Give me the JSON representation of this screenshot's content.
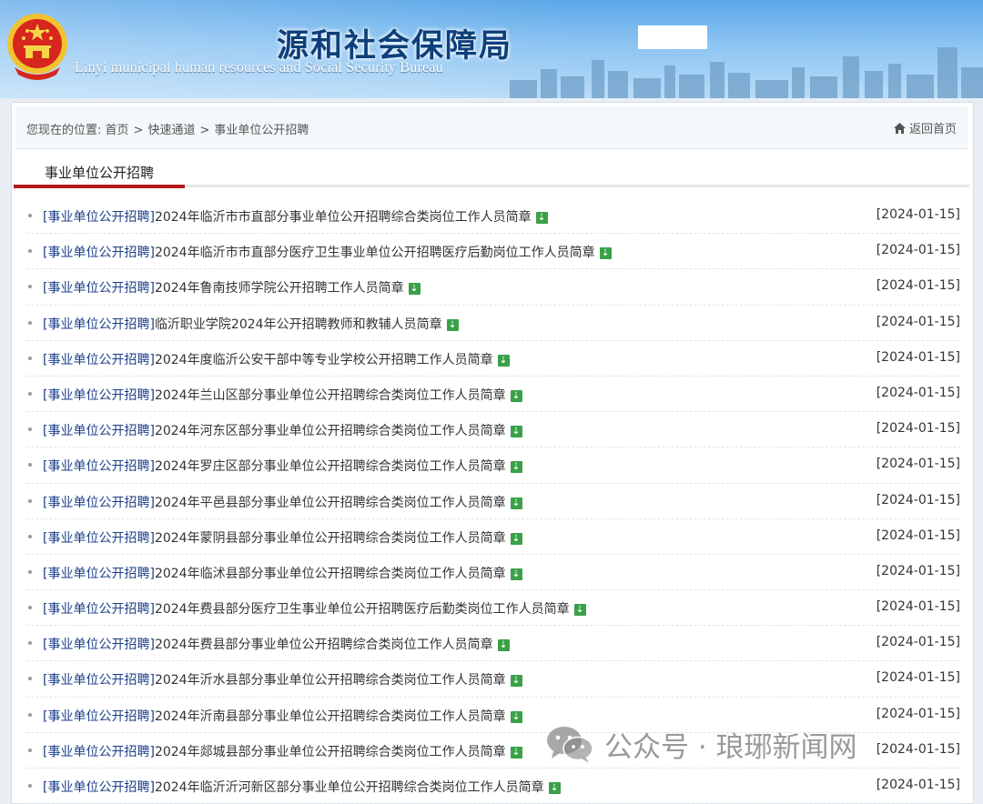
{
  "header": {
    "title": "源和社会保障局",
    "subtitle": "Linyi municipal human resources and Social Security Bureau"
  },
  "breadcrumb": {
    "prefix": "您现在的位置:",
    "items": [
      "首页",
      "快速通道",
      "事业单位公开招聘"
    ],
    "separator": ">",
    "back_home": "返回首页"
  },
  "section": {
    "tab_label": "事业单位公开招聘"
  },
  "colors": {
    "accent_red": "#b01a1a",
    "new_icon_green": "#3aa148",
    "title_blue": "#0d3f7a"
  },
  "icons": {
    "emblem": "national-emblem",
    "home": "home-icon",
    "new": "new-badge-icon",
    "watermark": "wechat-icon"
  },
  "news": [
    {
      "category": "[事业单位公开招聘]",
      "title": "2024年临沂市市直部分事业单位公开招聘综合类岗位工作人员简章",
      "date": "[2024-01-15]"
    },
    {
      "category": "[事业单位公开招聘]",
      "title": "2024年临沂市市直部分医疗卫生事业单位公开招聘医疗后勤岗位工作人员简章",
      "date": "[2024-01-15]"
    },
    {
      "category": "[事业单位公开招聘]",
      "title": "2024年鲁南技师学院公开招聘工作人员简章",
      "date": "[2024-01-15]"
    },
    {
      "category": "[事业单位公开招聘]",
      "title": "临沂职业学院2024年公开招聘教师和教辅人员简章",
      "date": "[2024-01-15]"
    },
    {
      "category": "[事业单位公开招聘]",
      "title": "2024年度临沂公安干部中等专业学校公开招聘工作人员简章",
      "date": "[2024-01-15]"
    },
    {
      "category": "[事业单位公开招聘]",
      "title": "2024年兰山区部分事业单位公开招聘综合类岗位工作人员简章",
      "date": "[2024-01-15]"
    },
    {
      "category": "[事业单位公开招聘]",
      "title": "2024年河东区部分事业单位公开招聘综合类岗位工作人员简章",
      "date": "[2024-01-15]"
    },
    {
      "category": "[事业单位公开招聘]",
      "title": "2024年罗庄区部分事业单位公开招聘综合类岗位工作人员简章",
      "date": "[2024-01-15]"
    },
    {
      "category": "[事业单位公开招聘]",
      "title": "2024年平邑县部分事业单位公开招聘综合类岗位工作人员简章",
      "date": "[2024-01-15]"
    },
    {
      "category": "[事业单位公开招聘]",
      "title": "2024年蒙阴县部分事业单位公开招聘综合类岗位工作人员简章",
      "date": "[2024-01-15]"
    },
    {
      "category": "[事业单位公开招聘]",
      "title": "2024年临沭县部分事业单位公开招聘综合类岗位工作人员简章",
      "date": "[2024-01-15]"
    },
    {
      "category": "[事业单位公开招聘]",
      "title": "2024年费县部分医疗卫生事业单位公开招聘医疗后勤类岗位工作人员简章",
      "date": "[2024-01-15]"
    },
    {
      "category": "[事业单位公开招聘]",
      "title": "2024年费县部分事业单位公开招聘综合类岗位工作人员简章",
      "date": "[2024-01-15]"
    },
    {
      "category": "[事业单位公开招聘]",
      "title": "2024年沂水县部分事业单位公开招聘综合类岗位工作人员简章",
      "date": "[2024-01-15]"
    },
    {
      "category": "[事业单位公开招聘]",
      "title": "2024年沂南县部分事业单位公开招聘综合类岗位工作人员简章",
      "date": "[2024-01-15]"
    },
    {
      "category": "[事业单位公开招聘]",
      "title": "2024年郯城县部分事业单位公开招聘综合类岗位工作人员简章",
      "date": "[2024-01-15]"
    },
    {
      "category": "[事业单位公开招聘]",
      "title": "2024年临沂沂河新区部分事业单位公开招聘综合类岗位工作人员简章",
      "date": "[2024-01-15]"
    }
  ],
  "watermark": {
    "text": "公众号 · 琅琊新闻网"
  }
}
